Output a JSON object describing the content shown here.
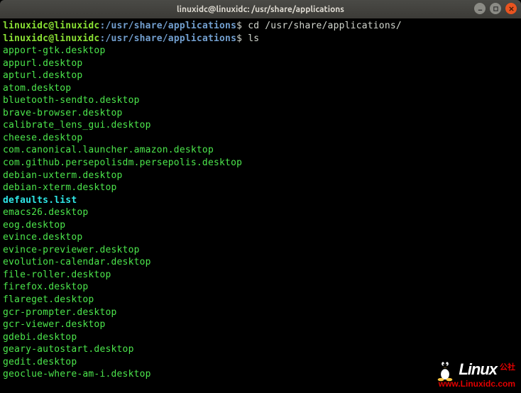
{
  "window": {
    "title": "linuxidc@linuxidc: /usr/share/applications"
  },
  "prompt1": {
    "user": "linuxidc@linuxidc",
    "colon": ":",
    "path": "/usr/share/applications",
    "dollar": "$",
    "command": "cd /usr/share/applications/"
  },
  "prompt2": {
    "user": "linuxidc@linuxidc",
    "colon": ":",
    "path": "/usr/share/applications",
    "dollar": "$",
    "command": "ls"
  },
  "files": [
    "apport-gtk.desktop",
    "appurl.desktop",
    "apturl.desktop",
    "atom.desktop",
    "bluetooth-sendto.desktop",
    "brave-browser.desktop",
    "calibrate_lens_gui.desktop",
    "cheese.desktop",
    "com.canonical.launcher.amazon.desktop",
    "com.github.persepolisdm.persepolis.desktop",
    "debian-uxterm.desktop",
    "debian-xterm.desktop",
    "defaults.list",
    "emacs26.desktop",
    "eog.desktop",
    "evince.desktop",
    "evince-previewer.desktop",
    "evolution-calendar.desktop",
    "file-roller.desktop",
    "firefox.desktop",
    "flareget.desktop",
    "gcr-prompter.desktop",
    "gcr-viewer.desktop",
    "gdebi.desktop",
    "geary-autostart.desktop",
    "gedit.desktop",
    "geoclue-where-am-i.desktop"
  ],
  "link_index": 12,
  "watermark": {
    "brand": "Linux",
    "suffix": "公社",
    "url": "www.Linuxidc.com"
  }
}
